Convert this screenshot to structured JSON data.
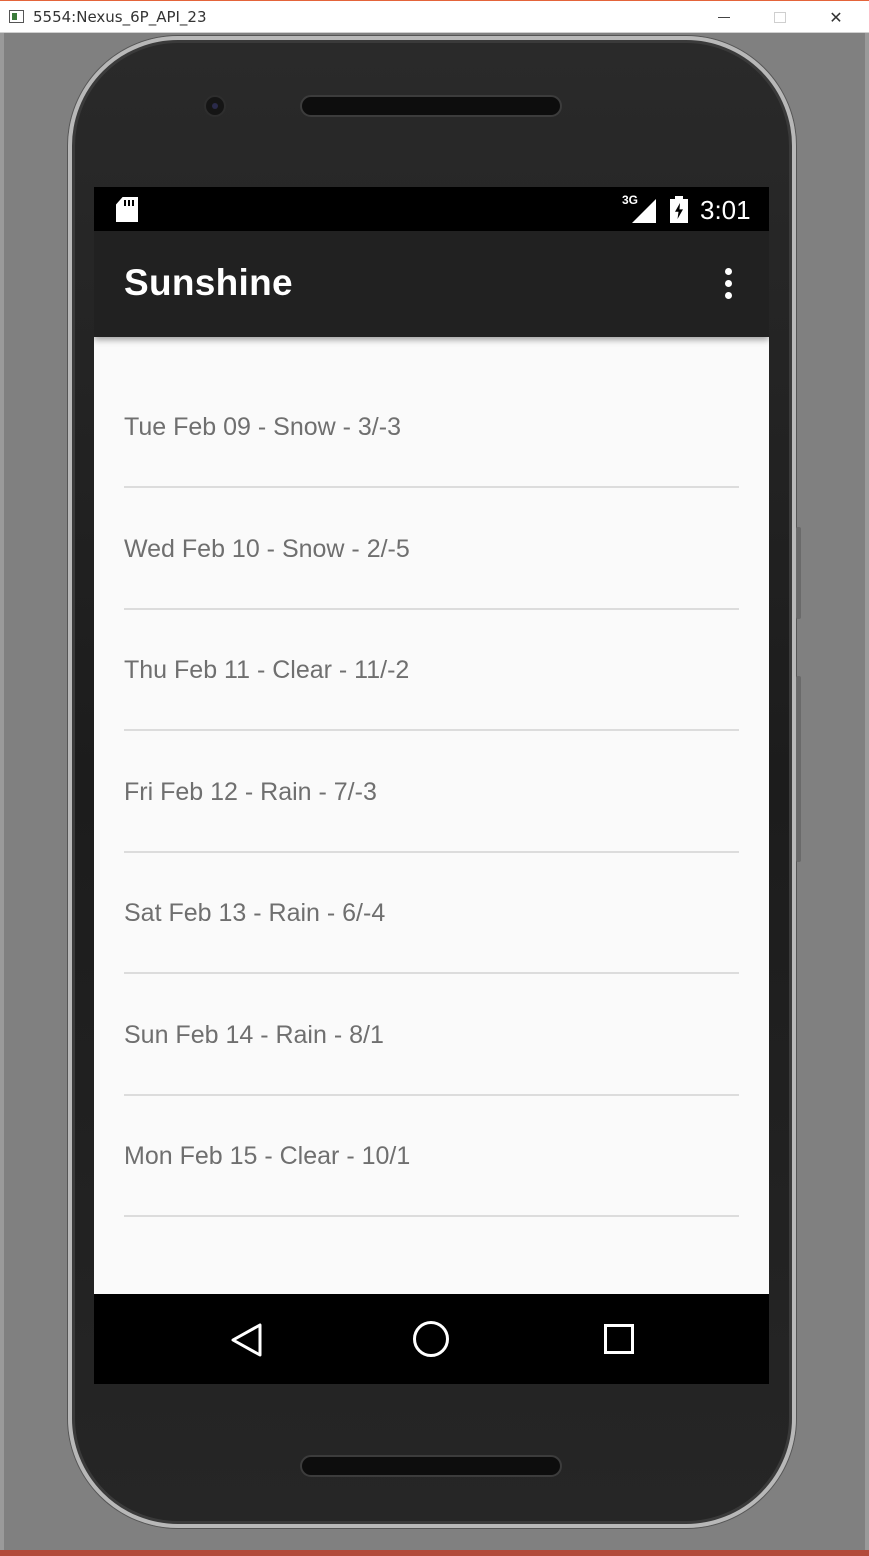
{
  "window": {
    "title": "5554:Nexus_6P_API_23",
    "minimize_icon": "minimize-icon",
    "maximize_icon": "maximize-icon",
    "close_glyph": "✕"
  },
  "status_bar": {
    "network": "3G",
    "time": "3:01",
    "icons": [
      "sd-card-icon",
      "cell-signal-icon",
      "battery-charging-icon"
    ]
  },
  "app_bar": {
    "title": "Sunshine",
    "overflow_icon": "overflow-menu-icon"
  },
  "forecast": [
    "Tue Feb 09 - Snow - 3/-3",
    "Wed Feb 10 - Snow - 2/-5",
    "Thu Feb 11 - Clear - 11/-2",
    "Fri Feb 12 - Rain - 7/-3",
    "Sat Feb 13 - Rain - 6/-4",
    "Sun Feb 14 - Rain - 8/1",
    "Mon Feb 15 - Clear - 10/1"
  ],
  "nav_bar": {
    "icons": [
      "back-icon",
      "home-icon",
      "recent-apps-icon"
    ]
  },
  "colors": {
    "app_bar": "#212121",
    "list_background": "#fafafa",
    "list_text": "#6f6f6f",
    "divider": "#dcdcdc"
  }
}
